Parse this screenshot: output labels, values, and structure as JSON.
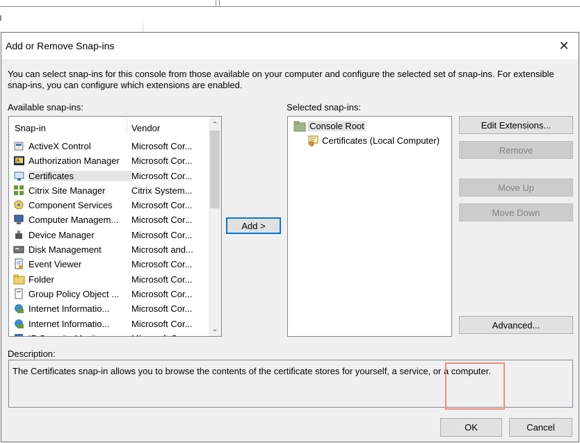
{
  "dialog": {
    "title": "Add or Remove Snap-ins",
    "close_glyph": "✕",
    "intro": "You can select snap-ins for this console from those available on your computer and configure the selected set of snap-ins. For extensible snap-ins, you can configure which extensions are enabled."
  },
  "available": {
    "label": "Available snap-ins:",
    "col_snapin": "Snap-in",
    "col_vendor": "Vendor",
    "items": [
      {
        "name": "ActiveX Control",
        "vendor": "Microsoft Cor...",
        "icon": "activex-icon"
      },
      {
        "name": "Authorization Manager",
        "vendor": "Microsoft Cor...",
        "icon": "authorization-icon"
      },
      {
        "name": "Certificates",
        "vendor": "Microsoft Cor...",
        "icon": "certificates-icon",
        "selected": true
      },
      {
        "name": "Citrix Site Manager",
        "vendor": "Citrix System...",
        "icon": "citrix-icon"
      },
      {
        "name": "Component Services",
        "vendor": "Microsoft Cor...",
        "icon": "component-services-icon"
      },
      {
        "name": "Computer Managem...",
        "vendor": "Microsoft Cor...",
        "icon": "computer-management-icon"
      },
      {
        "name": "Device Manager",
        "vendor": "Microsoft Cor...",
        "icon": "device-manager-icon"
      },
      {
        "name": "Disk Management",
        "vendor": "Microsoft and...",
        "icon": "disk-management-icon"
      },
      {
        "name": "Event Viewer",
        "vendor": "Microsoft Cor...",
        "icon": "event-viewer-icon"
      },
      {
        "name": "Folder",
        "vendor": "Microsoft Cor...",
        "icon": "folder-icon"
      },
      {
        "name": "Group Policy Object ...",
        "vendor": "Microsoft Cor...",
        "icon": "group-policy-icon"
      },
      {
        "name": "Internet Informatio...",
        "vendor": "Microsoft Cor...",
        "icon": "iis-icon"
      },
      {
        "name": "Internet Informatio...",
        "vendor": "Microsoft Cor...",
        "icon": "iis-icon"
      },
      {
        "name": "IP Security Monitor",
        "vendor": "Microsoft Cor...",
        "icon": "ip-security-icon"
      }
    ]
  },
  "add_button": "Add >",
  "selected": {
    "label": "Selected snap-ins:",
    "root": "Console Root",
    "child": "Certificates (Local Computer)"
  },
  "side_buttons": {
    "edit_extensions": "Edit Extensions...",
    "remove": "Remove",
    "move_up": "Move Up",
    "move_down": "Move Down",
    "advanced": "Advanced..."
  },
  "description": {
    "label": "Description:",
    "text": "The Certificates snap-in allows you to browse the contents of the certificate stores for yourself, a service, or a computer."
  },
  "footer": {
    "ok": "OK",
    "cancel": "Cancel"
  },
  "colors": {
    "dialog_bg": "#f0f0f0",
    "focus_border": "#0078d7",
    "highlight_annotation": "#f08a7e"
  }
}
